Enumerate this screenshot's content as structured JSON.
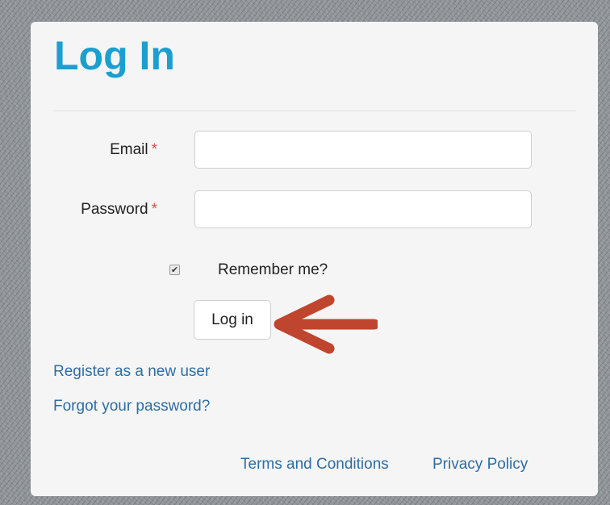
{
  "colors": {
    "title": "#1a9fd0",
    "link": "#2e6da4",
    "required": "#d9534f",
    "arrow": "#c0452e",
    "panel_background": "#f5f5f5"
  },
  "heading": {
    "title": "Log In"
  },
  "form": {
    "email": {
      "label": "Email",
      "required_marker": "*",
      "value": "",
      "placeholder": ""
    },
    "password": {
      "label": "Password",
      "required_marker": "*",
      "value": "",
      "placeholder": ""
    },
    "remember_me": {
      "label": "Remember me?",
      "checked": true,
      "check_glyph": "✔"
    },
    "submit_label": "Log in"
  },
  "annotation": {
    "arrow_icon": "left-arrow-icon",
    "points_to": "login-button"
  },
  "links": {
    "register": "Register as a new user",
    "forgot_password": "Forgot your password?"
  },
  "footer": {
    "terms": "Terms and Conditions",
    "privacy": "Privacy Policy"
  }
}
